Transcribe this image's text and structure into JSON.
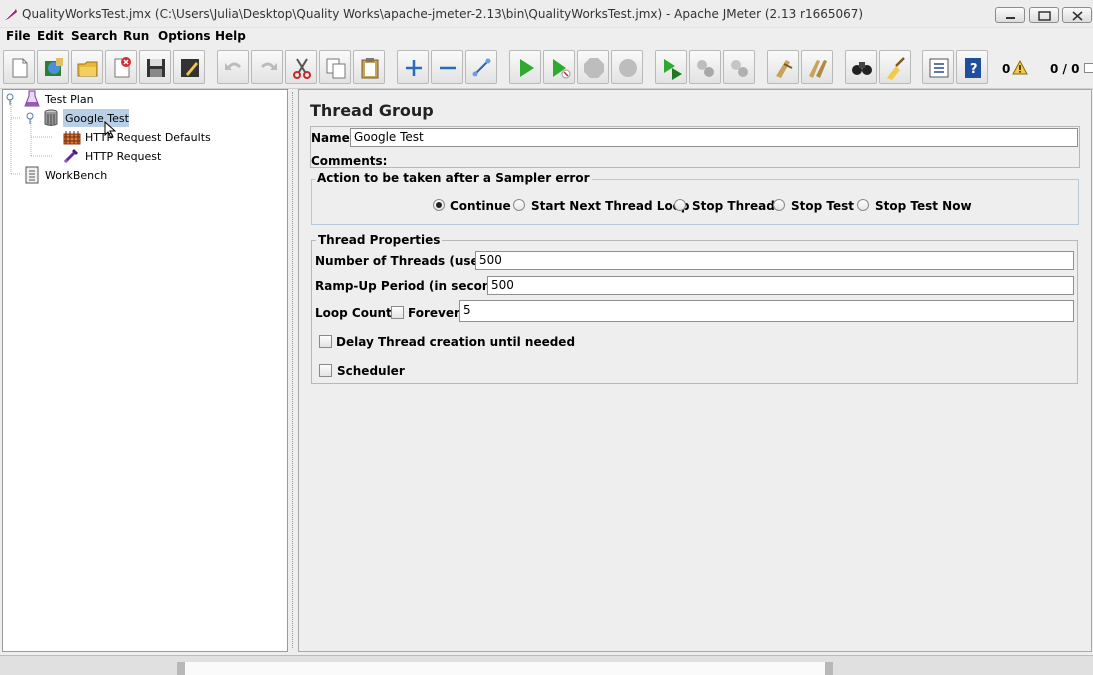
{
  "window": {
    "title": "QualityWorksTest.jmx (C:\\Users\\Julia\\Desktop\\Quality Works\\apache-jmeter-2.13\\bin\\QualityWorksTest.jmx) - Apache JMeter (2.13 r1665067)"
  },
  "menu": [
    "File",
    "Edit",
    "Search",
    "Run",
    "Options",
    "Help"
  ],
  "toolbar": {
    "error_count": "0",
    "thread_count": "0 / 0"
  },
  "tree": {
    "test_plan": "Test Plan",
    "thread_group": "Google Test",
    "http_defaults": "HTTP Request Defaults",
    "http_request": "HTTP Request",
    "workbench": "WorkBench"
  },
  "panel": {
    "title": "Thread Group",
    "name_label": "Name:",
    "name_value": "Google Test",
    "comments_label": "Comments:",
    "sampler_error": {
      "legend": "Action to be taken after a Sampler error",
      "options": [
        "Continue",
        "Start Next Thread Loop",
        "Stop Thread",
        "Stop Test",
        "Stop Test Now"
      ],
      "selected": "Continue"
    },
    "thread_properties": {
      "legend": "Thread Properties",
      "threads_label": "Number of Threads (users):",
      "threads_value": "500",
      "rampup_label": "Ramp-Up Period (in seconds):",
      "rampup_value": "500",
      "loop_label": "Loop Count:",
      "forever_label": "Forever",
      "forever_checked": false,
      "loop_value": "5",
      "delay_label": "Delay Thread creation until needed",
      "delay_checked": false,
      "scheduler_label": "Scheduler",
      "scheduler_checked": false
    }
  },
  "icons": {
    "toolbar": [
      "new-icon",
      "templates-icon",
      "open-icon",
      "close-icon",
      "save-icon",
      "save-as-icon",
      "undo-icon",
      "redo-icon",
      "cut-icon",
      "copy-icon",
      "paste-icon",
      "expand-icon",
      "collapse-icon",
      "toggle-icon",
      "start-icon",
      "start-no-pauses-icon",
      "stop-icon",
      "shutdown-icon",
      "remote-start-icon",
      "remote-stop-icon",
      "remote-shutdown-icon",
      "clear-icon",
      "clear-all-icon",
      "search-icon",
      "reset-search-icon",
      "function-helper-icon",
      "help-icon"
    ]
  }
}
